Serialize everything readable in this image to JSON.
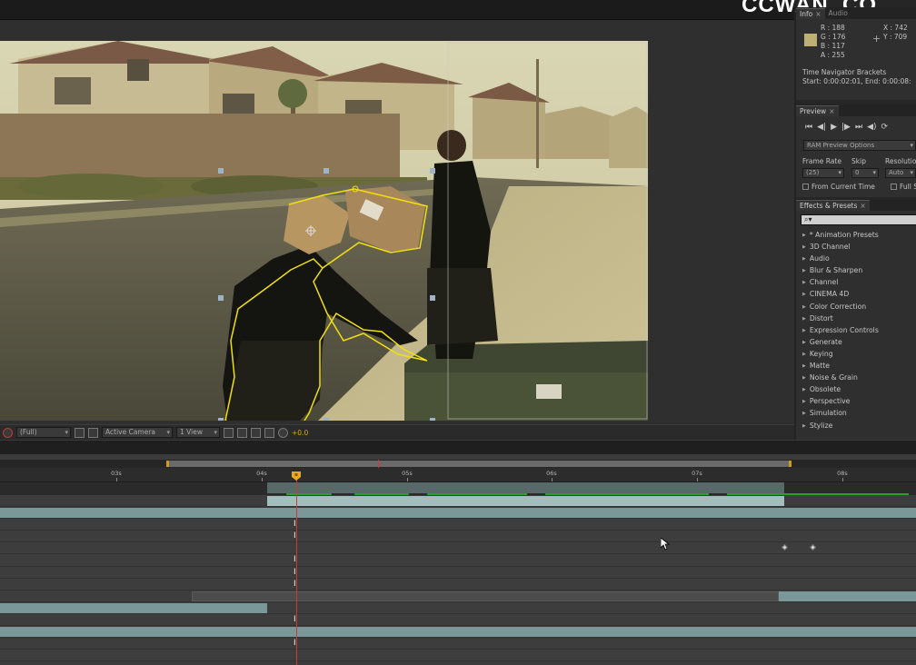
{
  "viewer": {
    "resolution": "(Full)",
    "camera": "Active Camera",
    "views": "1 View",
    "exposure": "+0.0"
  },
  "info_panel": {
    "tabs": [
      "Info",
      "Audio"
    ],
    "r": "R : 188",
    "g": "G : 176",
    "b": "B : 117",
    "a": "A : 255",
    "x": "X : 742",
    "y": "Y : 709",
    "swatch_color": "#bcb075",
    "nav_title": "Time Navigator Brackets",
    "nav_range": "Start: 0:00:02:01, End: 0:00:08:"
  },
  "preview_panel": {
    "tab": "Preview",
    "buttons": [
      "first-frame-icon",
      "prev-frame-icon",
      "play-icon",
      "next-frame-icon",
      "last-frame-icon",
      "audio-icon",
      "loop-icon"
    ],
    "options": "RAM Preview Options",
    "frame_rate_label": "Frame Rate",
    "skip_label": "Skip",
    "resolution_label": "Resolution",
    "frame_rate_value": "(25)",
    "skip_value": "0",
    "resolution_value": "Auto",
    "from_current_time": "From Current Time",
    "full_screen": "Full S"
  },
  "effects_panel": {
    "tab": "Effects & Presets",
    "search_placeholder": "⌕▾",
    "items": [
      "* Animation Presets",
      "3D Channel",
      "Audio",
      "Blur & Sharpen",
      "Channel",
      "CINEMA 4D",
      "Color Correction",
      "Distort",
      "Expression Controls",
      "Generate",
      "Keying",
      "Matte",
      "Noise & Grain",
      "Obsolete",
      "Perspective",
      "Simulation",
      "Stylize"
    ]
  },
  "timeline": {
    "ruler": [
      "03s",
      "04s",
      "05s",
      "06s",
      "07s",
      "08s"
    ],
    "playhead_time": "04s"
  },
  "watermark": "CCWAN .CO"
}
